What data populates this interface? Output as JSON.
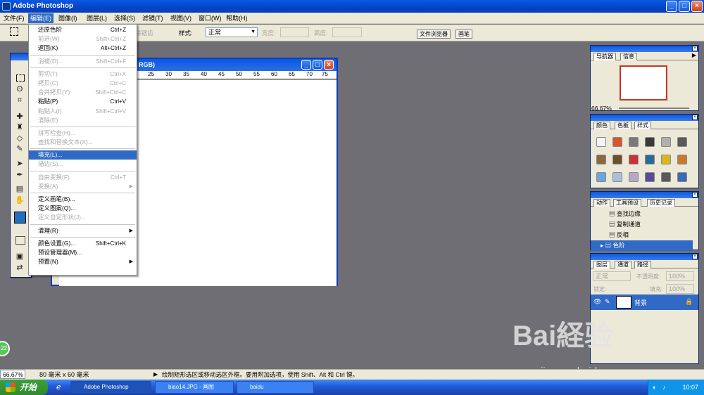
{
  "app": {
    "title": "Adobe Photoshop"
  },
  "menubar": {
    "items": [
      "文件(F)",
      "编辑(E)",
      "图像(I)",
      "图层(L)",
      "选择(S)",
      "滤镜(T)",
      "视图(V)",
      "窗口(W)",
      "帮助(H)"
    ]
  },
  "options": {
    "feather_label": "除锯齿",
    "style_label": "样式:",
    "style_value": "正常",
    "width_label": "宽度:",
    "height_label": "高度:",
    "tab_file_browser": "文件浏览器",
    "tab_brushes": "画笔"
  },
  "document": {
    "title": "RGB)",
    "ruler": [
      "25",
      "30",
      "35",
      "40",
      "45",
      "50",
      "55",
      "60",
      "65",
      "70",
      "75"
    ]
  },
  "edit_menu": {
    "items": [
      {
        "label": "还原色阶",
        "shortcut": "Ctrl+Z",
        "disabled": false
      },
      {
        "label": "前进(W)",
        "shortcut": "Shift+Ctrl+Z",
        "disabled": true
      },
      {
        "label": "返回(K)",
        "shortcut": "Alt+Ctrl+Z",
        "disabled": false
      },
      {
        "sep": true
      },
      {
        "label": "消褪(D)...",
        "shortcut": "Shift+Ctrl+F",
        "disabled": true
      },
      {
        "sep": true
      },
      {
        "label": "剪切(T)",
        "shortcut": "Ctrl+X",
        "disabled": true
      },
      {
        "label": "拷贝(C)",
        "shortcut": "Ctrl+C",
        "disabled": true
      },
      {
        "label": "合并拷贝(Y)",
        "shortcut": "Shift+Ctrl+C",
        "disabled": true
      },
      {
        "label": "粘贴(P)",
        "shortcut": "Ctrl+V",
        "disabled": false
      },
      {
        "label": "粘贴入(I)",
        "shortcut": "Shift+Ctrl+V",
        "disabled": true
      },
      {
        "label": "清除(E)",
        "shortcut": "",
        "disabled": true
      },
      {
        "sep": true
      },
      {
        "label": "拼写检查(H)...",
        "shortcut": "",
        "disabled": true
      },
      {
        "label": "查找和替换文本(X)...",
        "shortcut": "",
        "disabled": true
      },
      {
        "sep": true
      },
      {
        "label": "填充(L)...",
        "shortcut": "",
        "disabled": false,
        "selected": true
      },
      {
        "label": "描边(S)...",
        "shortcut": "",
        "disabled": true
      },
      {
        "sep": true
      },
      {
        "label": "自由变换(F)",
        "shortcut": "Ctrl+T",
        "disabled": true
      },
      {
        "label": "变换(A)",
        "shortcut": "",
        "disabled": true,
        "submenu": true
      },
      {
        "sep": true
      },
      {
        "label": "定义画笔(B)...",
        "shortcut": "",
        "disabled": false
      },
      {
        "label": "定义图案(Q)...",
        "shortcut": "",
        "disabled": false
      },
      {
        "label": "定义自定形状(J)...",
        "shortcut": "",
        "disabled": true
      },
      {
        "sep": true
      },
      {
        "label": "清理(R)",
        "shortcut": "",
        "disabled": false,
        "submenu": true
      },
      {
        "sep": true
      },
      {
        "label": "颜色设置(G)...",
        "shortcut": "Shift+Ctrl+K",
        "disabled": false
      },
      {
        "label": "预设管理器(M)...",
        "shortcut": "",
        "disabled": false
      },
      {
        "label": "预置(N)",
        "shortcut": "",
        "disabled": false,
        "submenu": true
      }
    ]
  },
  "navigator": {
    "tabs": [
      "导航器",
      "信息"
    ],
    "zoom": "66.67%"
  },
  "swatches_panel": {
    "tabs": [
      "颜色",
      "色板",
      "样式"
    ]
  },
  "actions_panel": {
    "tabs": [
      "动作",
      "工具预设",
      "历史记录"
    ],
    "items": [
      "查找边缘",
      "复制通道",
      "反相",
      "色阶"
    ]
  },
  "layers_panel": {
    "tabs": [
      "图层",
      "通道",
      "路径"
    ],
    "blend": "正常",
    "opacity_label": "不透明度:",
    "opacity": "100%",
    "lock_label": "锁定:",
    "fill_label": "填充:",
    "fill": "100%",
    "layer_name": "背景"
  },
  "status": {
    "zoom": "66.67%",
    "size": "80 毫米 x 60 毫米",
    "hint": "绘制矩形选区或移动选区外框。要用附加选项，使用 Shift、Alt 和 Ctrl 键。"
  },
  "taskbar": {
    "start": "开始",
    "tasks": [
      "Adobe Photoshop",
      "biao14.JPG - 画图",
      "baidu"
    ],
    "time": "10:07"
  },
  "watermark": {
    "logo": "Bai経验",
    "sub": "jingyan.baidu.com"
  },
  "colors": {
    "accent": "#316ac5",
    "xp_blue": "#0a58e2",
    "fg_color": "#1f6fc1"
  }
}
